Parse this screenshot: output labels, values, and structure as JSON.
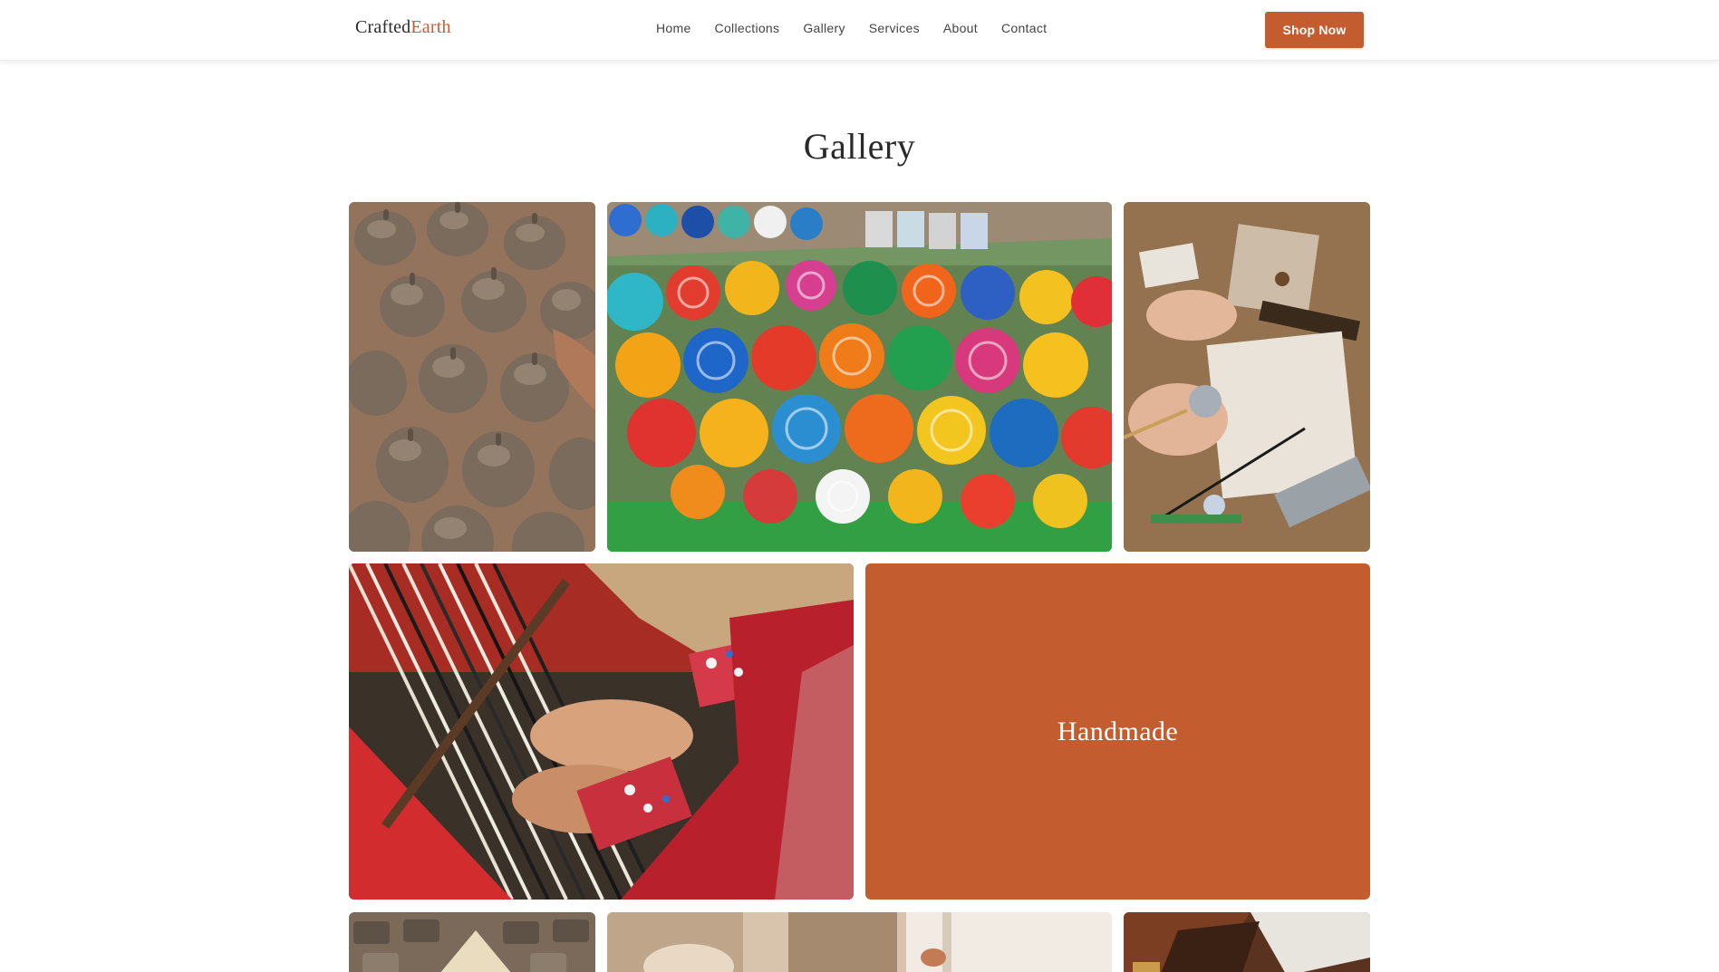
{
  "header": {
    "logo_part1": "Crafted",
    "logo_part2": "Earth",
    "nav": [
      "Home",
      "Collections",
      "Gallery",
      "Services",
      "About",
      "Contact"
    ],
    "cta_label": "Shop Now"
  },
  "gallery": {
    "title": "Gallery",
    "overlay_label": "Handmade",
    "images": [
      {
        "name": "clay-pots-image",
        "subject": "unglazed clay pots"
      },
      {
        "name": "painted-bowls-image",
        "subject": "colorful painted bowls"
      },
      {
        "name": "craftsperson-workbench-image",
        "subject": "artisan workbench"
      },
      {
        "name": "weaving-loom-image",
        "subject": "hands weaving on loom"
      },
      {
        "name": "pottery-row-image",
        "subject": "pottery with conical hat"
      },
      {
        "name": "artisan-window-image",
        "subject": "artisan near window"
      },
      {
        "name": "leather-craft-image",
        "subject": "leather pieces"
      }
    ]
  },
  "colors": {
    "accent": "#c35c2f",
    "text_dark": "#2b2b2b",
    "background": "#ffffff"
  }
}
